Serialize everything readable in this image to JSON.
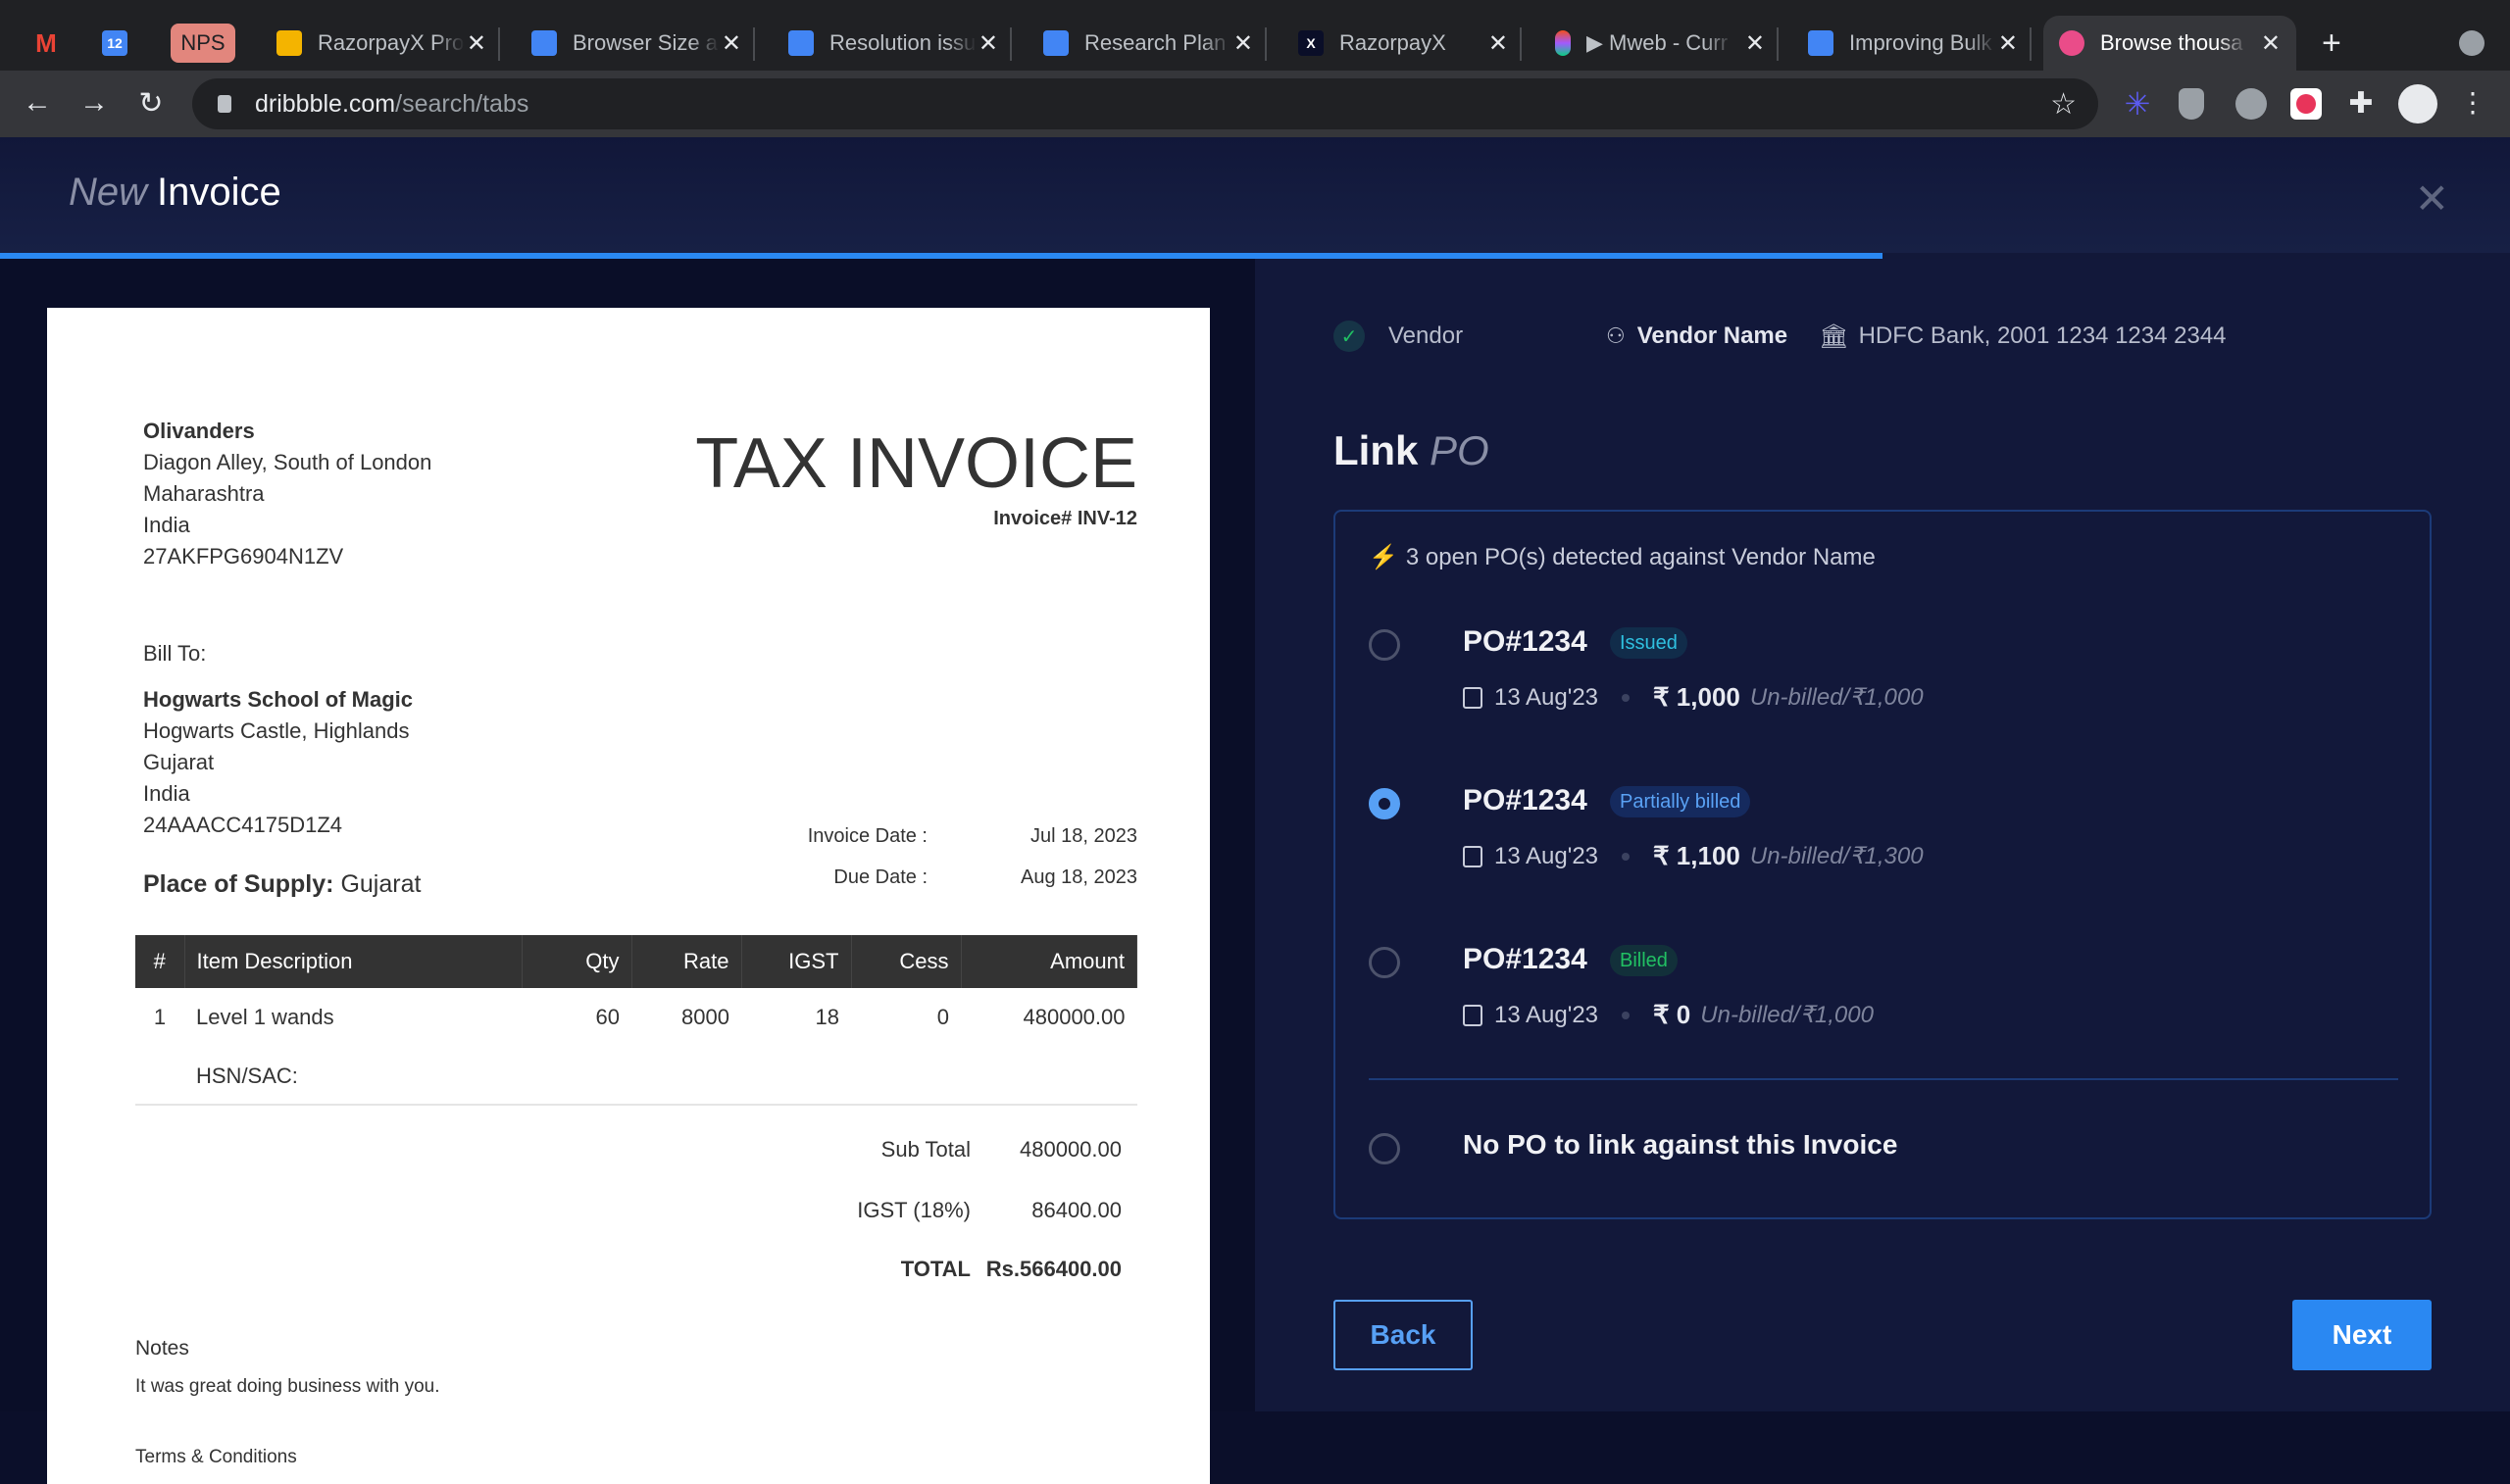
{
  "browser": {
    "tabs": [
      {
        "icon": "gmail-icon",
        "title": ""
      },
      {
        "icon": "calendar-icon",
        "title": ""
      },
      {
        "icon": "nps-icon",
        "title": "NPS"
      },
      {
        "icon": "slides-icon",
        "title": "RazorpayX Pro"
      },
      {
        "icon": "docs-icon",
        "title": "Browser Size a"
      },
      {
        "icon": "docs-icon",
        "title": "Resolution issu"
      },
      {
        "icon": "docs-icon",
        "title": "Research Plan"
      },
      {
        "icon": "razorpayx-icon",
        "title": "RazorpayX"
      },
      {
        "icon": "figma-icon",
        "title": "▶ Mweb - Curr"
      },
      {
        "icon": "docs-icon",
        "title": "Improving Bulk"
      },
      {
        "icon": "dribbble-icon",
        "title": "Browse thousa"
      }
    ],
    "url_host": "dribbble.com",
    "url_path": "/search/tabs",
    "new_tab": "+"
  },
  "header": {
    "title_prefix": "New",
    "title": "Invoice",
    "progress_percent": 75,
    "accent": "#2a88f2"
  },
  "invoice": {
    "seller": {
      "name": "Olivanders",
      "lines": [
        "Diagon Alley, South of London",
        "Maharashtra",
        "India",
        "27AKFPG6904N1ZV"
      ]
    },
    "doc_title": "TAX INVOICE",
    "invoice_no": "Invoice# INV-12",
    "bill_to_label": "Bill To:",
    "buyer": {
      "name": "Hogwarts School of Magic",
      "lines": [
        "Hogwarts Castle, Highlands",
        "Gujarat",
        "India",
        "24AAACC4175D1Z4"
      ]
    },
    "place_label": "Place of Supply:",
    "place_value": "Gujarat",
    "invoice_date_label": "Invoice Date :",
    "invoice_date": "Jul 18, 2023",
    "due_date_label": "Due Date :",
    "due_date": "Aug 18, 2023",
    "columns": [
      "#",
      "Item Description",
      "Qty",
      "Rate",
      "IGST",
      "Cess",
      "Amount"
    ],
    "rows": [
      {
        "no": "1",
        "desc": "Level 1 wands",
        "qty": "60",
        "rate": "8000",
        "igst": "18",
        "cess": "0",
        "amount": "480000.00",
        "hsn": "HSN/SAC:"
      }
    ],
    "subtotal_label": "Sub Total",
    "subtotal": "480000.00",
    "igst_label": "IGST (18%)",
    "igst": "86400.00",
    "total_label": "TOTAL",
    "total": "Rs.566400.00",
    "notes_label": "Notes",
    "notes": "It was great doing business with you.",
    "terms_label": "Terms & Conditions"
  },
  "vendor": {
    "step_label": "Vendor",
    "name": "Vendor Name",
    "bank": "HDFC Bank, 2001 1234 1234 2344"
  },
  "link_po": {
    "heading_bold": "Link",
    "heading_italic": "PO",
    "detected": "3 open PO(s) detected against Vendor Name",
    "options": [
      {
        "name": "PO#1234",
        "status": "Issued",
        "status_color": "#2fc0e0",
        "status_bg": "#112c4a",
        "date": "13 Aug'23",
        "amount": "₹ 1,000",
        "unbilled": "Un-billed/₹1,000",
        "selected": false
      },
      {
        "name": "PO#1234",
        "status": "Partially billed",
        "status_color": "#5aa2f5",
        "status_bg": "#152a5e",
        "date": "13 Aug'23",
        "amount": "₹ 1,100",
        "unbilled": "Un-billed/₹1,300",
        "selected": true
      },
      {
        "name": "PO#1234",
        "status": "Billed",
        "status_color": "#21c063",
        "status_bg": "#12303a",
        "date": "13 Aug'23",
        "amount": "₹ 0",
        "unbilled": "Un-billed/₹1,000",
        "selected": false
      }
    ],
    "no_po_label": "No PO to link against this Invoice"
  },
  "actions": {
    "back": "Back",
    "next": "Next"
  }
}
